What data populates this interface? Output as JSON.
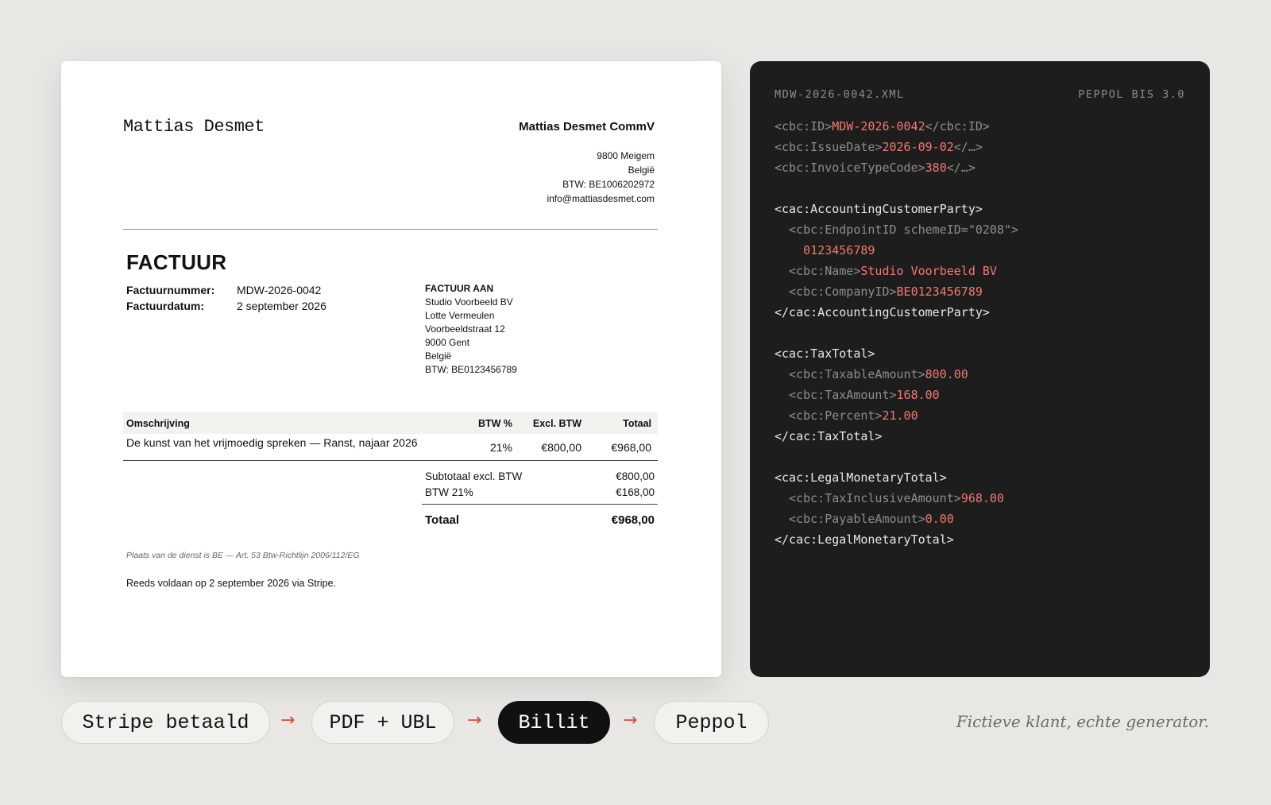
{
  "invoice": {
    "brand": "Mattias Desmet",
    "company_name": "Mattias Desmet CommV",
    "company_lines": [
      "9800 Meigem",
      "België",
      "BTW: BE1006202972",
      "info@mattiasdesmet.com"
    ],
    "title": "FACTUUR",
    "meta": [
      {
        "label": "Factuurnummer:",
        "value": "MDW-2026-0042"
      },
      {
        "label": "Factuurdatum:",
        "value": "2 september 2026"
      }
    ],
    "bill_to": {
      "heading": "FACTUUR AAN",
      "lines": [
        "Studio Voorbeeld BV",
        "Lotte Vermeulen",
        "Voorbeeldstraat 12",
        "9000 Gent",
        "België",
        "BTW: BE0123456789"
      ]
    },
    "table": {
      "headers": [
        "Omschrijving",
        "BTW %",
        "Excl. BTW",
        "Totaal"
      ],
      "rows": [
        [
          "De kunst van het vrijmoedig spreken — Ranst, najaar 2026",
          "21%",
          "€800,00",
          "€968,00"
        ]
      ]
    },
    "totals": {
      "subtotal_label": "Subtotaal excl. BTW",
      "subtotal_value": "€800,00",
      "vat_label": "BTW 21%",
      "vat_value": "€168,00",
      "total_label": "Totaal",
      "total_value": "€968,00"
    },
    "legal_note": "Plaats van de dienst is BE — Art. 53 Btw-Richtlijn 2006/112/EG",
    "paid_note": "Reeds voldaan op 2 september 2026 via Stripe."
  },
  "xml": {
    "filename": "MDW-2026-0042.XML",
    "standard": "PEPPOL BIS 3.0",
    "lines": [
      [
        {
          "c": "g",
          "t": "<cbc:ID>"
        },
        {
          "c": "v",
          "t": "MDW-2026-0042"
        },
        {
          "c": "g",
          "t": "</cbc:ID>"
        }
      ],
      [
        {
          "c": "g",
          "t": "<cbc:IssueDate>"
        },
        {
          "c": "v",
          "t": "2026-09-02"
        },
        {
          "c": "g",
          "t": "</…>"
        }
      ],
      [
        {
          "c": "g",
          "t": "<cbc:InvoiceTypeCode>"
        },
        {
          "c": "v",
          "t": "380"
        },
        {
          "c": "g",
          "t": "</…>"
        }
      ],
      [],
      [
        {
          "c": "w",
          "t": "<cac:AccountingCustomerParty>"
        }
      ],
      [
        {
          "c": "g",
          "t": "  <cbc:EndpointID schemeID=\"0208\">"
        }
      ],
      [
        {
          "c": "v",
          "t": "    0123456789"
        }
      ],
      [
        {
          "c": "g",
          "t": "  <cbc:Name>"
        },
        {
          "c": "v",
          "t": "Studio Voorbeeld BV"
        }
      ],
      [
        {
          "c": "g",
          "t": "  <cbc:CompanyID>"
        },
        {
          "c": "v",
          "t": "BE0123456789"
        }
      ],
      [
        {
          "c": "w",
          "t": "</cac:AccountingCustomerParty>"
        }
      ],
      [],
      [
        {
          "c": "w",
          "t": "<cac:TaxTotal>"
        }
      ],
      [
        {
          "c": "g",
          "t": "  <cbc:TaxableAmount>"
        },
        {
          "c": "v",
          "t": "800.00"
        }
      ],
      [
        {
          "c": "g",
          "t": "  <cbc:TaxAmount>"
        },
        {
          "c": "v",
          "t": "168.00"
        }
      ],
      [
        {
          "c": "g",
          "t": "  <cbc:Percent>"
        },
        {
          "c": "v",
          "t": "21.00"
        }
      ],
      [
        {
          "c": "w",
          "t": "</cac:TaxTotal>"
        }
      ],
      [],
      [
        {
          "c": "w",
          "t": "<cac:LegalMonetaryTotal>"
        }
      ],
      [
        {
          "c": "g",
          "t": "  <cbc:TaxInclusiveAmount>"
        },
        {
          "c": "v",
          "t": "968.00"
        }
      ],
      [
        {
          "c": "g",
          "t": "  <cbc:PayableAmount>"
        },
        {
          "c": "v",
          "t": "0.00"
        }
      ],
      [
        {
          "c": "w",
          "t": "</cac:LegalMonetaryTotal>"
        }
      ]
    ]
  },
  "pipeline": {
    "steps": [
      "Stripe betaald",
      "PDF + UBL",
      "Billit",
      "Peppol"
    ],
    "arrow": "→",
    "note": "Fictieve klant, echte generator."
  },
  "colors": {
    "accent": "#d84a3a",
    "xml_value": "#f2796e",
    "xml_bg": "#1d1d1d",
    "page_bg": "#e8e7e3"
  }
}
